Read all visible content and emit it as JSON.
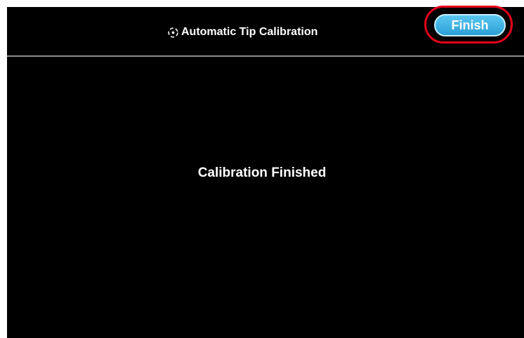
{
  "header": {
    "title": "Automatic Tip Calibration",
    "title_icon": "calibration-target-icon",
    "finish_label": "Finish"
  },
  "main": {
    "message": "Calibration Finished"
  },
  "colors": {
    "background": "#000000",
    "accent_button": "#2a9fd6",
    "highlight_ring": "#e4001a",
    "text": "#ffffff"
  }
}
